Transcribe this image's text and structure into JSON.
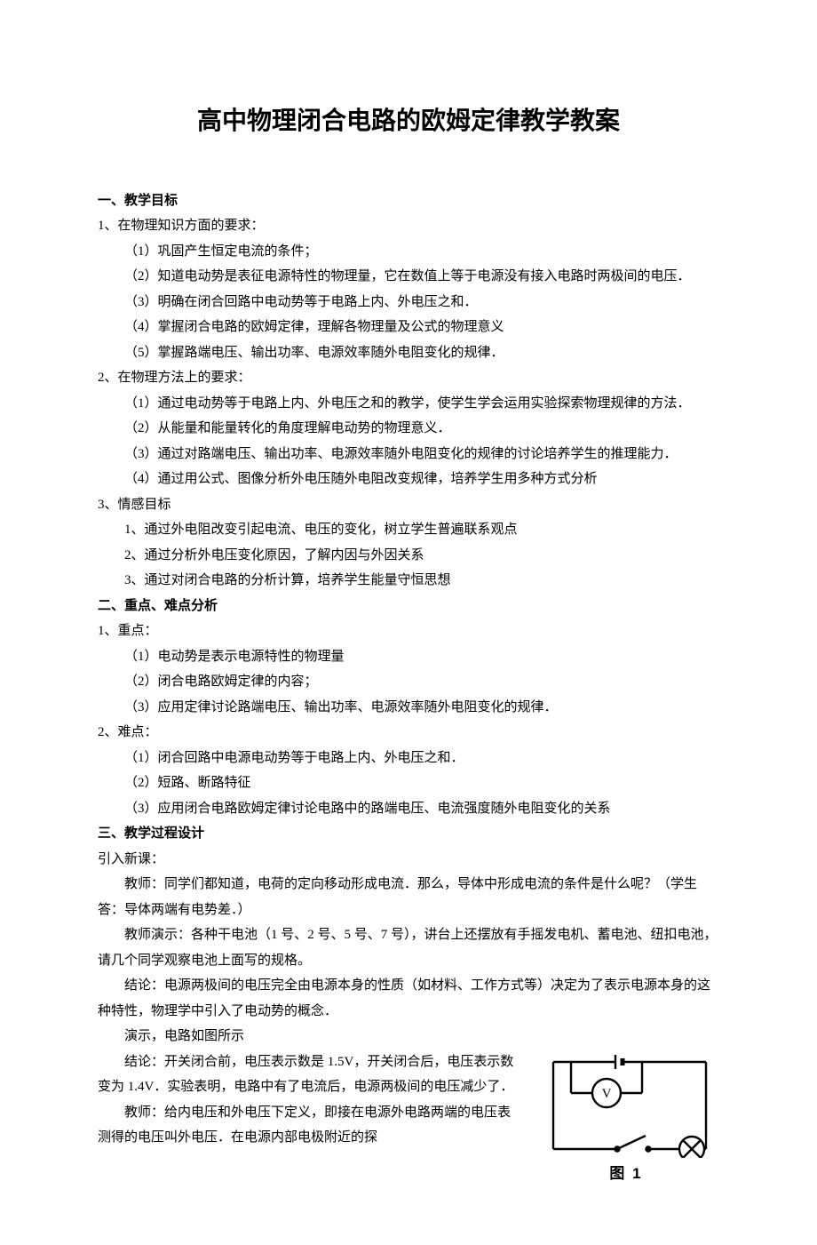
{
  "title": "高中物理闭合电路的欧姆定律教学教案",
  "sections": {
    "s1": {
      "heading": "一、教学目标",
      "g1": {
        "label": "1、在物理知识方面的要求：",
        "items": [
          "（1）巩固产生恒定电流的条件；",
          "（2）知道电动势是表征电源特性的物理量，它在数值上等于电源没有接入电路时两极间的电压．",
          "（3）明确在闭合回路中电动势等于电路上内、外电压之和．",
          "（4）掌握闭合电路的欧姆定律，理解各物理量及公式的物理意义",
          "（5）掌握路端电压、输出功率、电源效率随外电阻变化的规律．"
        ]
      },
      "g2": {
        "label": "2、在物理方法上的要求：",
        "items": [
          "（1）通过电动势等于电路上内、外电压之和的教学，使学生学会运用实验探索物理规律的方法．",
          "（2）从能量和能量转化的角度理解电动势的物理意义．",
          "（3）通过对路端电压、输出功率、电源效率随外电阻变化的规律的讨论培养学生的推理能力．",
          "（4）通过用公式、图像分析外电压随外电阻改变规律，培养学生用多种方式分析"
        ]
      },
      "g3": {
        "label": "3、情感目标",
        "items": [
          "1、通过外电阻改变引起电流、电压的变化，树立学生普遍联系观点",
          "2、通过分析外电压变化原因，了解内因与外因关系",
          "3、通过对闭合电路的分析计算，培养学生能量守恒思想"
        ]
      }
    },
    "s2": {
      "heading": "二、重点、难点分析",
      "g1": {
        "label": "1、重点：",
        "items": [
          "（1）电动势是表示电源特性的物理量",
          "（2）闭合电路欧姆定律的内容；",
          "（3）应用定律讨论路端电压、输出功率、电源效率随外电阻变化的规律．"
        ]
      },
      "g2": {
        "label": "2、难点：",
        "items": [
          "（1）闭合回路中电源电动势等于电路上内、外电压之和．",
          "（2）短路、断路特征",
          "（3）应用闭合电路欧姆定律讨论电路中的路端电压、电流强度随外电阻变化的关系"
        ]
      }
    },
    "s3": {
      "heading": "三、教学过程设计",
      "intro": "引入新课：",
      "paras": [
        "教师：同学们都知道，电荷的定向移动形成电流．那么，导体中形成电流的条件是什么呢？（学生答：导体两端有电势差．）",
        "教师演示：各种干电池（1 号、2 号、5 号、7 号），讲台上还摆放有手摇发电机、蓄电池、纽扣电池，请几个同学观察电池上面写的规格。",
        "结论：电源两极间的电压完全由电源本身的性质（如材料、工作方式等）决定为了表示电源本身的这种特性，物理学中引入了电动势的概念．",
        "演示，电路如图所示"
      ],
      "wrap_paras": [
        "结论：开关闭合前，电压表示数是 1.5V，开关闭合后，电压表示数变为 1.4V．实验表明，电路中有了电流后，电源两极间的电压减少了．",
        "教师：给内电压和外电压下定义，即接在电源外电路两端的电压表测得的电压叫外电压．在电源内部电极附近的探"
      ]
    }
  },
  "figure": {
    "caption": "图 1"
  }
}
